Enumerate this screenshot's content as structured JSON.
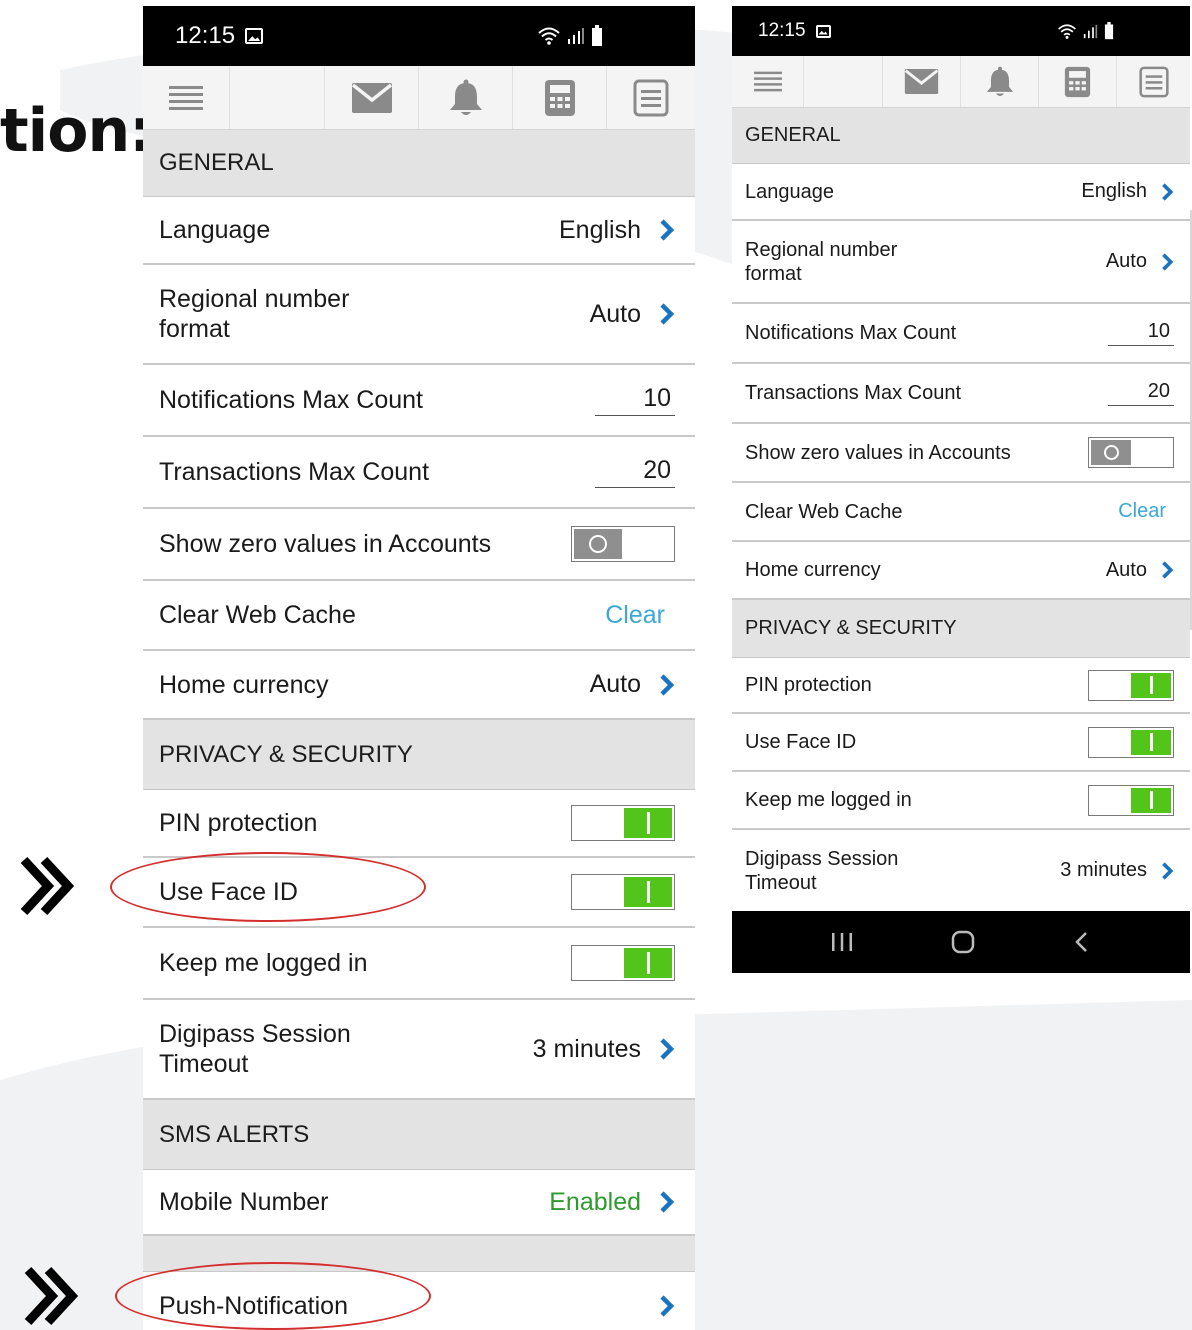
{
  "heading": {
    "fragment": "tion:"
  },
  "left_screen": {
    "status_bar": {
      "time": "12:15"
    },
    "toolbar_icons": [
      "menu-icon",
      "mail-icon",
      "bell-icon",
      "calculator-icon",
      "document-icon"
    ],
    "general_header": "GENERAL",
    "language": {
      "label": "Language",
      "value": "English"
    },
    "regional": {
      "label": "Regional number format",
      "value": "Auto"
    },
    "notif_max": {
      "label": "Notifications Max Count",
      "value": "10"
    },
    "trans_max": {
      "label": "Transactions Max Count",
      "value": "20"
    },
    "show_zero": {
      "label": "Show zero values in Accounts",
      "state": "off"
    },
    "clear_cache": {
      "label": "Clear Web Cache",
      "action": "Clear"
    },
    "home_currency": {
      "label": "Home currency",
      "value": "Auto"
    },
    "privacy_header": "PRIVACY & SECURITY",
    "pin": {
      "label": "PIN protection",
      "state": "on"
    },
    "face_id": {
      "label": "Use Face ID",
      "state": "on"
    },
    "keep_logged": {
      "label": "Keep me logged in",
      "state": "on"
    },
    "digipass": {
      "label": "Digipass Session Timeout",
      "value": "3 minutes"
    },
    "sms_header": "SMS ALERTS",
    "mobile_number": {
      "label": "Mobile Number",
      "value": "Enabled"
    },
    "push": {
      "label": "Push-Notification"
    }
  },
  "right_screen": {
    "status_bar": {
      "time": "12:15"
    },
    "toolbar_icons": [
      "menu-icon",
      "mail-icon",
      "bell-icon",
      "calculator-icon",
      "document-icon"
    ],
    "general_header": "GENERAL",
    "language": {
      "label": "Language",
      "value": "English"
    },
    "regional": {
      "label": "Regional number format",
      "value": "Auto"
    },
    "notif_max": {
      "label": "Notifications Max Count",
      "value": "10"
    },
    "trans_max": {
      "label": "Transactions Max Count",
      "value": "20"
    },
    "show_zero": {
      "label": "Show zero values in Accounts",
      "state": "off"
    },
    "clear_cache": {
      "label": "Clear Web Cache",
      "action": "Clear"
    },
    "home_currency": {
      "label": "Home currency",
      "value": "Auto"
    },
    "privacy_header": "PRIVACY & SECURITY",
    "pin": {
      "label": "PIN protection",
      "state": "on"
    },
    "face_id": {
      "label": "Use Face ID",
      "state": "on"
    },
    "keep_logged": {
      "label": "Keep me logged in",
      "state": "on"
    },
    "digipass": {
      "label": "Digipass Session Timeout",
      "value": "3 minutes"
    },
    "nav_icons": [
      "recent-apps-icon",
      "home-icon",
      "back-icon"
    ]
  },
  "colors": {
    "accent_blue": "#1a73c2",
    "link_blue": "#3ba7d6",
    "toggle_green": "#52c41a",
    "enabled_green": "#2e9a2e",
    "highlight_red": "#d32f2f"
  }
}
